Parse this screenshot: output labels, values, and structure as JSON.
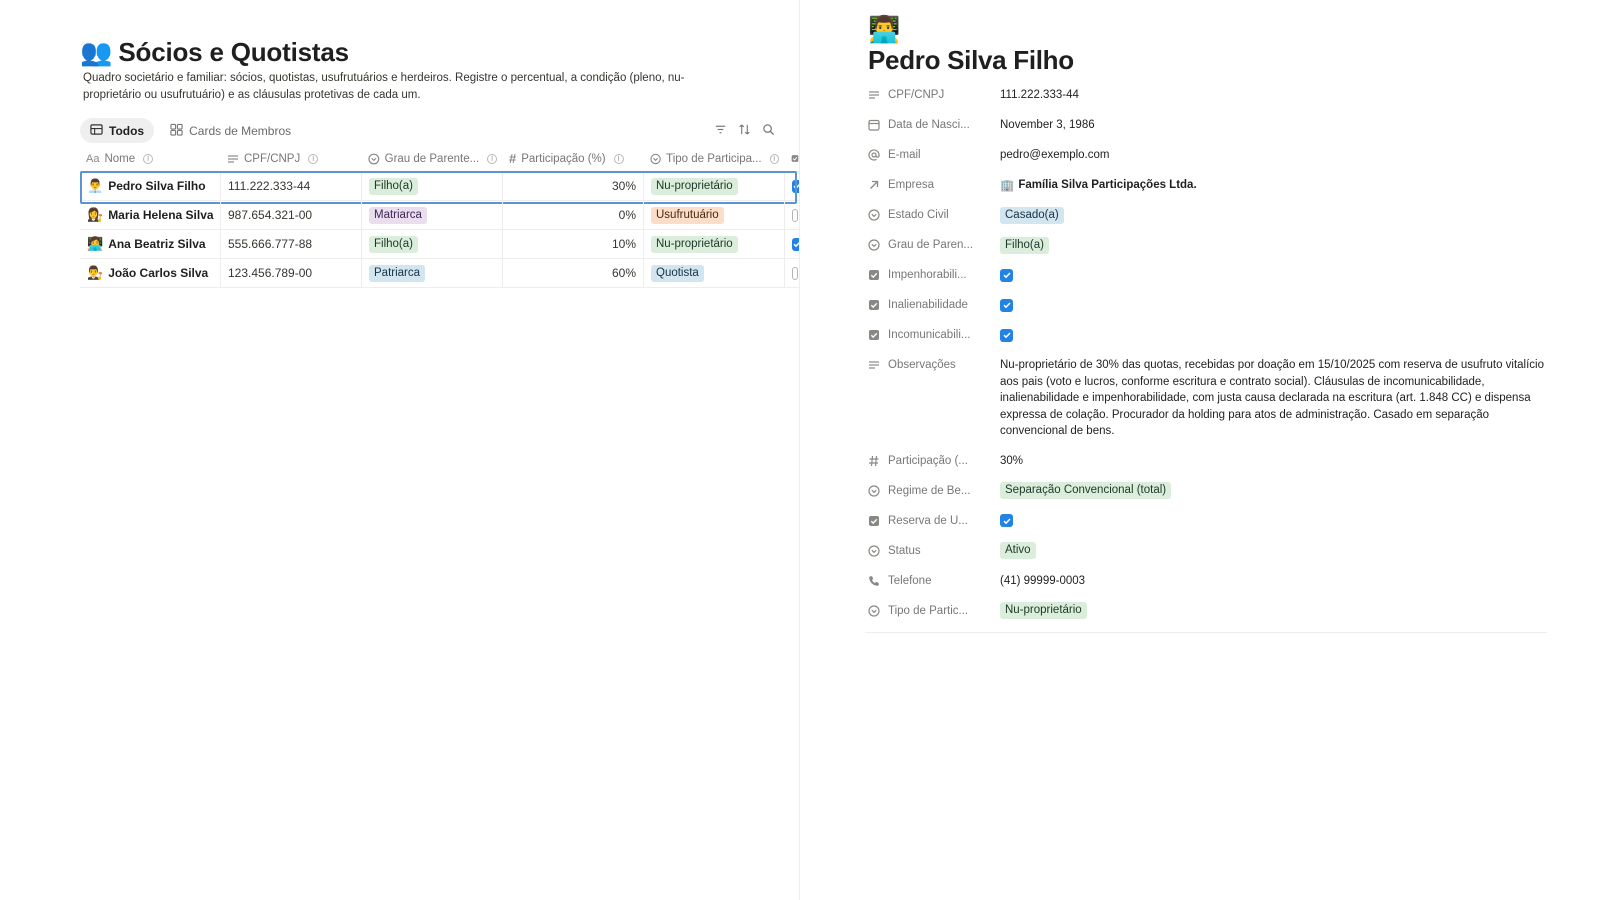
{
  "database": {
    "emoji": "👥",
    "title": "Sócios e Quotistas",
    "description": "Quadro societário e familiar: sócios, quotistas, usufrutuários e herdeiros. Registre o percentual, a condição (pleno, nu-proprietário ou usufrutuário) e as cláusulas protetivas de cada um."
  },
  "views": [
    {
      "label": "Todos",
      "icon": "table-icon",
      "active": true
    },
    {
      "label": "Cards de Membros",
      "icon": "gallery-icon",
      "active": false
    }
  ],
  "toolbar": {
    "icons": [
      "filter-icon",
      "sort-icon",
      "search-icon"
    ]
  },
  "columns": [
    {
      "label": "Nome",
      "icon": "Aa"
    },
    {
      "label": "CPF/CNPJ",
      "icon": "text-icon"
    },
    {
      "label": "Grau de Parente...",
      "icon": "select-icon"
    },
    {
      "label": "Participação (%)",
      "icon": "#"
    },
    {
      "label": "Tipo de Participa...",
      "icon": "select-icon"
    }
  ],
  "rows": [
    {
      "emoji": "👨‍💼",
      "name": "Pedro Silva Filho",
      "cpf": "111.222.333-44",
      "grau": "Filho(a)",
      "grau_color": "#dbeddb",
      "grau_text": "#1c3829",
      "part": "30%",
      "tipo": "Nu-proprietário",
      "tipo_color": "#dbeddb",
      "tipo_text": "#1c3829",
      "checked": true,
      "selected": true
    },
    {
      "emoji": "👩‍⚖️",
      "name": "Maria Helena Silva",
      "cpf": "987.654.321-00",
      "grau": "Matriarca",
      "grau_color": "#e8deee",
      "grau_text": "#412454",
      "part": "0%",
      "tipo": "Usufrutuário",
      "tipo_color": "#fadec9",
      "tipo_text": "#49290e",
      "checked": false,
      "selected": false
    },
    {
      "emoji": "👩‍💻",
      "name": "Ana Beatriz Silva",
      "cpf": "555.666.777-88",
      "grau": "Filho(a)",
      "grau_color": "#dbeddb",
      "grau_text": "#1c3829",
      "part": "10%",
      "tipo": "Nu-proprietário",
      "tipo_color": "#dbeddb",
      "tipo_text": "#1c3829",
      "checked": true,
      "selected": false
    },
    {
      "emoji": "👨‍⚖️",
      "name": "João Carlos Silva",
      "cpf": "123.456.789-00",
      "grau": "Patriarca",
      "grau_color": "#d3e5ef",
      "grau_text": "#183347",
      "part": "60%",
      "tipo": "Quotista",
      "tipo_color": "#d3e5ef",
      "tipo_text": "#183347",
      "checked": false,
      "selected": false
    }
  ],
  "detail": {
    "emoji": "👨‍💻",
    "title": "Pedro Silva Filho",
    "properties": [
      {
        "key": "CPF/CNPJ",
        "icon": "text-icon",
        "type": "text",
        "value": "111.222.333-44"
      },
      {
        "key": "Data de Nasci...",
        "icon": "calendar-icon",
        "type": "text",
        "value": "November 3, 1986"
      },
      {
        "key": "E-mail",
        "icon": "at-icon",
        "type": "text",
        "value": "pedro@exemplo.com"
      },
      {
        "key": "Empresa",
        "icon": "relation-icon",
        "type": "link",
        "value": "Família Silva Participações Ltda.",
        "link_emoji": "🏢"
      },
      {
        "key": "Estado Civil",
        "icon": "select-icon",
        "type": "tag",
        "value": "Casado(a)",
        "color": "#d3e5ef",
        "text": "#183347"
      },
      {
        "key": "Grau de Paren...",
        "icon": "select-icon",
        "type": "tag",
        "value": "Filho(a)",
        "color": "#dbeddb",
        "text": "#1c3829"
      },
      {
        "key": "Impenhorabili...",
        "icon": "checkbox-icon",
        "type": "checkbox",
        "value": true
      },
      {
        "key": "Inalienabilidade",
        "icon": "checkbox-icon",
        "type": "checkbox",
        "value": true
      },
      {
        "key": "Incomunicabili...",
        "icon": "checkbox-icon",
        "type": "checkbox",
        "value": true
      },
      {
        "key": "Observações",
        "icon": "text-icon",
        "type": "multi",
        "value": "Nu-proprietário de 30% das quotas, recebidas por doação em 15/10/2025 com reserva de usufruto vitalício aos pais (voto e lucros, conforme escritura e contrato social). Cláusulas de incomunicabilidade, inalienabilidade e impenhorabilidade, com justa causa declarada na escritura (art. 1.848 CC) e dispensa expressa de colação. Procurador da holding para atos de administração. Casado em separação convencional de bens."
      },
      {
        "key": "Participação (...",
        "icon": "number-icon",
        "type": "text",
        "value": "30%"
      },
      {
        "key": "Regime de Be...",
        "icon": "select-icon",
        "type": "tag",
        "value": "Separação Convencional (total)",
        "color": "#dbeddb",
        "text": "#1c3829"
      },
      {
        "key": "Reserva de U...",
        "icon": "checkbox-icon",
        "type": "checkbox",
        "value": true
      },
      {
        "key": "Status",
        "icon": "select-icon",
        "type": "tag",
        "value": "Ativo",
        "color": "#dbeddb",
        "text": "#1c3829"
      },
      {
        "key": "Telefone",
        "icon": "phone-icon",
        "type": "text",
        "value": "(41) 99999-0003"
      },
      {
        "key": "Tipo de Partic...",
        "icon": "select-icon",
        "type": "tag",
        "value": "Nu-proprietário",
        "color": "#dbeddb",
        "text": "#1c3829"
      }
    ]
  }
}
